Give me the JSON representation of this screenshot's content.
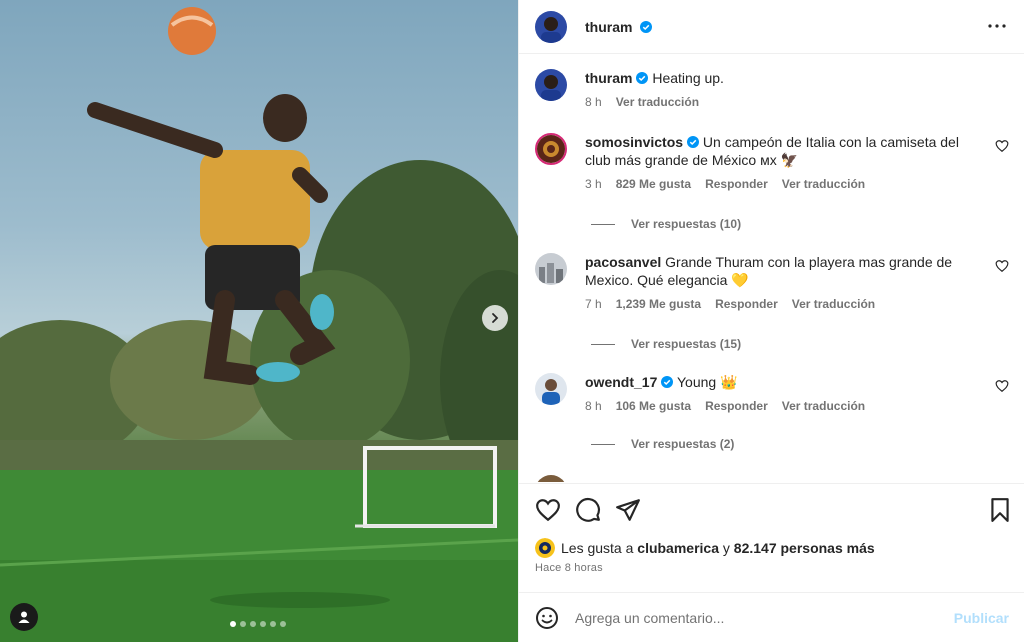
{
  "post": {
    "author": "thuram",
    "verified": true,
    "carousel": {
      "total": 6,
      "active": 1
    }
  },
  "caption": {
    "author": "thuram",
    "text": "Heating up.",
    "age": "8 h",
    "translate": "Ver traducción"
  },
  "comments": [
    {
      "author": "somosinvictos",
      "verified": true,
      "line1": "Un campeón de Italia con la camiseta del",
      "line2": "club más grande de México ᴍx 🦅",
      "age": "3 h",
      "likes": "829 Me gusta",
      "reply": "Responder",
      "translate": "Ver traducción",
      "replies": "Ver respuestas (10)"
    },
    {
      "author": "pacosanvel",
      "verified": false,
      "line1": "Grande Thuram con la playera mas grande de",
      "line2": "Mexico. Qué elegancia 💛",
      "age": "7 h",
      "likes": "1,239 Me gusta",
      "reply": "Responder",
      "translate": "Ver traducción",
      "replies": "Ver respuestas (15)"
    },
    {
      "author": "owendt_17",
      "verified": true,
      "line1": "Young 👑",
      "age": "8 h",
      "likes": "106 Me gusta",
      "reply": "Responder",
      "translate": "Ver traducción",
      "replies": "Ver respuestas (2)"
    }
  ],
  "likes": {
    "prefix": "Les gusta a",
    "user": "clubamerica",
    "middle": "y",
    "others": "82.147 personas más"
  },
  "timestamp": "Hace 8 horas",
  "comment_box": {
    "placeholder": "Agrega un comentario...",
    "post_label": "Publicar"
  },
  "colors": {
    "verified": "#0095f6",
    "publish_disabled": "#b2dffc",
    "text": "#262626",
    "muted": "#737373"
  },
  "icons": [
    "more-options-icon",
    "heart-icon",
    "comment-icon",
    "share-icon",
    "save-icon",
    "emoji-icon",
    "chevron-right-icon",
    "tag-user-icon",
    "verified-badge-icon"
  ]
}
